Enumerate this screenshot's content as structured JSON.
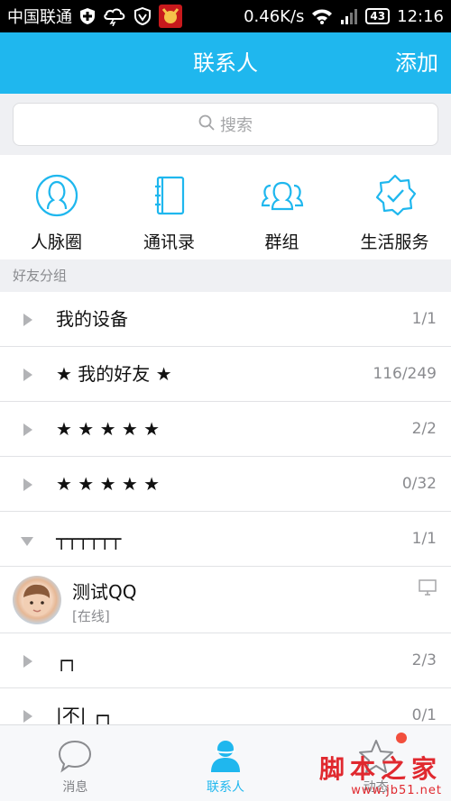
{
  "status_bar": {
    "carrier": "中国联通",
    "speed": "0.46K/s",
    "battery": "43",
    "time": "12:16"
  },
  "header": {
    "title": "联系人",
    "add_label": "添加"
  },
  "search": {
    "placeholder": "搜索"
  },
  "quick_nav": [
    {
      "label": "人脉圈",
      "icon": "person-circle-icon"
    },
    {
      "label": "通讯录",
      "icon": "address-book-icon"
    },
    {
      "label": "群组",
      "icon": "group-icon"
    },
    {
      "label": "生活服务",
      "icon": "service-badge-icon"
    }
  ],
  "section_title": "好友分组",
  "groups": [
    {
      "name": "我的设备",
      "count": "1/1",
      "expanded": false
    },
    {
      "name": "★ 我的好友 ★",
      "count": "116/249",
      "expanded": false
    },
    {
      "name": " ★ ★ ★ ★ ★",
      "count": "2/2",
      "expanded": false
    },
    {
      "name": " ★ ★ ★ ★ ★",
      "count": "0/32",
      "expanded": false
    },
    {
      "name": "┬┬┬┬┬┬",
      "count": "1/1",
      "expanded": true
    },
    {
      "name": "┌┐",
      "count": "2/3",
      "expanded": false
    },
    {
      "name": "|不|  ┌┐",
      "count": "0/1",
      "expanded": false
    }
  ],
  "friend": {
    "name": "测试QQ",
    "status": "[在线]"
  },
  "tabs": [
    {
      "label": "消息",
      "icon": "chat-bubble-icon"
    },
    {
      "label": "联系人",
      "icon": "contact-person-icon"
    },
    {
      "label": "动态",
      "icon": "star-icon"
    }
  ],
  "watermark": {
    "main": "脚本之家",
    "sub": "www.jb51.net"
  },
  "colors": {
    "accent": "#1fb7ee",
    "badge": "#f24f3d",
    "watermark": "#e0292f"
  }
}
